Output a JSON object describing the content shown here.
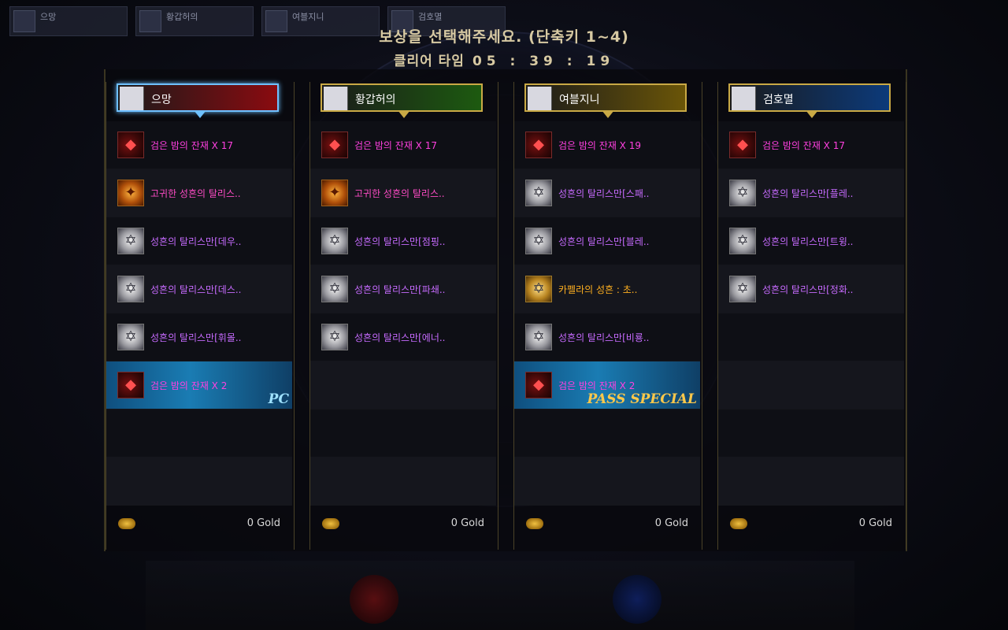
{
  "header": {
    "title": "보상을 선택해주세요. (단축키 1~4)",
    "clear_label": "클리어 타임",
    "clear_time": "05 : 39 : 19"
  },
  "party": [
    {
      "name": "으망"
    },
    {
      "name": "황갑허의"
    },
    {
      "name": "여블지니"
    },
    {
      "name": "검호멸"
    }
  ],
  "columns": [
    {
      "name": "으망",
      "plate_color": "#8a0b10",
      "active": true,
      "rows": [
        {
          "icon": "ember-icon",
          "label": "검은 밤의 잔재 X 17",
          "color": "magenta"
        },
        {
          "icon": "talisman-gold-icon",
          "label": "고귀한 성흔의 탈리스..",
          "color": "pink"
        },
        {
          "icon": "star-silver-icon",
          "label": "성흔의 탈리스만[데우..",
          "color": "purple"
        },
        {
          "icon": "star-silver-icon",
          "label": "성흔의 탈리스만[데스..",
          "color": "purple"
        },
        {
          "icon": "star-silver-icon",
          "label": "성흔의 탈리스만[휘몰..",
          "color": "purple"
        },
        {
          "icon": "ember-icon",
          "label": "검은 밤의 잔재 X 2",
          "color": "magenta",
          "tag": "PC",
          "bonus": "pc"
        }
      ],
      "gold": "0 Gold"
    },
    {
      "name": "황갑허의",
      "plate_color": "#1d5a10",
      "active": false,
      "rows": [
        {
          "icon": "ember-icon",
          "label": "검은 밤의 잔재 X 17",
          "color": "magenta"
        },
        {
          "icon": "talisman-gold-icon",
          "label": "고귀한 성흔의 탈리스..",
          "color": "pink"
        },
        {
          "icon": "star-silver-icon",
          "label": "성흔의 탈리스만[점핑..",
          "color": "purple"
        },
        {
          "icon": "star-silver-icon",
          "label": "성흔의 탈리스만[파쇄..",
          "color": "purple"
        },
        {
          "icon": "star-silver-icon",
          "label": "성흔의 탈리스만[에너..",
          "color": "purple"
        }
      ],
      "gold": "0 Gold"
    },
    {
      "name": "여블지니",
      "plate_color": "#6a5508",
      "active": false,
      "rows": [
        {
          "icon": "ember-icon",
          "label": "검은 밤의 잔재 X 19",
          "color": "magenta"
        },
        {
          "icon": "star-silver-icon",
          "label": "성흔의 탈리스만[스패..",
          "color": "purple"
        },
        {
          "icon": "star-silver-icon",
          "label": "성흔의 탈리스만[블레..",
          "color": "purple"
        },
        {
          "icon": "star-gold-icon",
          "label": "카펠라의 성흔 : 초..",
          "color": "gold"
        },
        {
          "icon": "star-silver-icon",
          "label": "성흔의 탈리스만[비룡..",
          "color": "purple"
        },
        {
          "icon": "ember-icon",
          "label": "검은 밤의 잔재 X 2",
          "color": "magenta",
          "tag": "PASS SPECIAL",
          "bonus": "pass"
        }
      ],
      "gold": "0 Gold"
    },
    {
      "name": "검호멸",
      "plate_color": "#0c3a7a",
      "active": false,
      "rows": [
        {
          "icon": "ember-icon",
          "label": "검은 밤의 잔재 X 17",
          "color": "magenta"
        },
        {
          "icon": "star-silver-icon",
          "label": "성흔의 탈리스만[플레..",
          "color": "purple"
        },
        {
          "icon": "star-silver-icon",
          "label": "성흔의 탈리스만[트윙..",
          "color": "purple"
        },
        {
          "icon": "star-silver-icon",
          "label": "성흔의 탈리스만[정화..",
          "color": "purple"
        }
      ],
      "gold": "0 Gold"
    }
  ]
}
